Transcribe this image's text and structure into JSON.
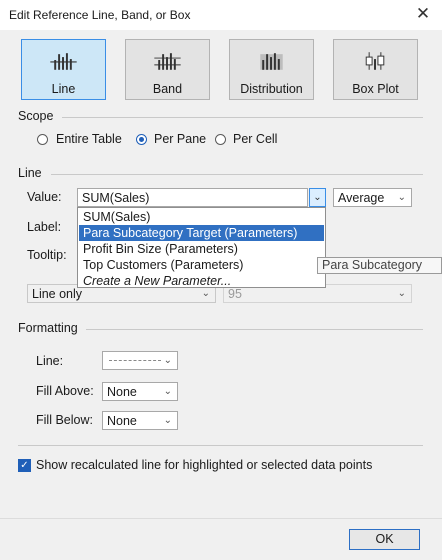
{
  "window": {
    "title": "Edit Reference Line, Band, or Box"
  },
  "types": [
    {
      "label": "Line",
      "icon": "line-icon",
      "selected": true
    },
    {
      "label": "Band",
      "icon": "band-icon",
      "selected": false
    },
    {
      "label": "Distribution",
      "icon": "distribution-icon",
      "selected": false
    },
    {
      "label": "Box Plot",
      "icon": "box-plot-icon",
      "selected": false
    }
  ],
  "scope": {
    "heading": "Scope",
    "options": [
      {
        "label": "Entire Table",
        "selected": false
      },
      {
        "label": "Per Pane",
        "selected": true
      },
      {
        "label": "Per Cell",
        "selected": false
      }
    ]
  },
  "line": {
    "heading": "Line",
    "value_label": "Value:",
    "value_selected": "SUM(Sales)",
    "aggregation": "Average",
    "label_label": "Label:",
    "tooltip_label": "Tooltip:",
    "line_only": "Line only",
    "confidence": "95",
    "dropdown_options": [
      {
        "text": "SUM(Sales)",
        "highlighted": false
      },
      {
        "text": "Para Subcategory Target (Parameters)",
        "highlighted": true
      },
      {
        "text": "Profit Bin Size (Parameters)",
        "highlighted": false
      },
      {
        "text": "Top Customers (Parameters)",
        "highlighted": false
      },
      {
        "text": "Create a New Parameter...",
        "highlighted": false
      }
    ],
    "hover_tooltip": "Para Subcategory"
  },
  "formatting": {
    "heading": "Formatting",
    "line_label": "Line:",
    "fill_above_label": "Fill Above:",
    "fill_above_value": "None",
    "fill_below_label": "Fill Below:",
    "fill_below_value": "None"
  },
  "recalc": {
    "label": "Show recalculated line for highlighted or selected data points",
    "checked": true
  },
  "buttons": {
    "ok": "OK"
  },
  "colors": {
    "accent": "#1f5fb8",
    "highlight": "#3070c2",
    "selected_tile": "#cde7f7"
  }
}
